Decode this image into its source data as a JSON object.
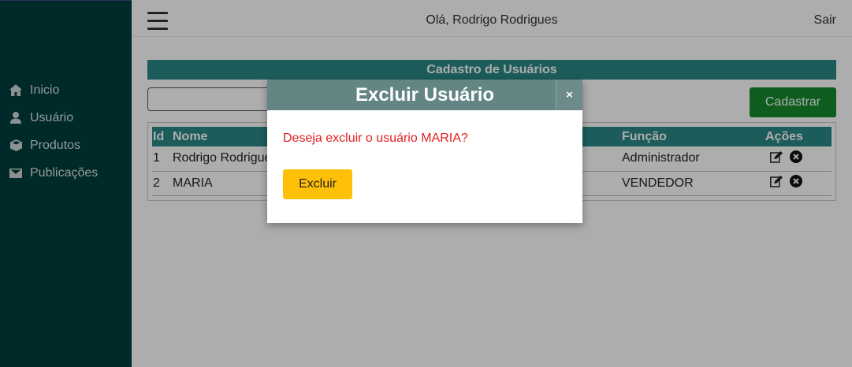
{
  "sidebar": {
    "items": [
      {
        "label": "Inicio",
        "icon": "home-icon"
      },
      {
        "label": "Usuário",
        "icon": "user-icon"
      },
      {
        "label": "Produtos",
        "icon": "cube-icon"
      },
      {
        "label": "Publicações",
        "icon": "envelope-icon"
      }
    ]
  },
  "header": {
    "greeting": "Olá, Rodrigo Rodrigues",
    "logout": "Sair"
  },
  "page": {
    "title": "Cadastro de Usuários",
    "search_value": "",
    "create_label": "Cadastrar"
  },
  "table": {
    "headers": {
      "id": "Id",
      "nome": "Nome",
      "funcao": "Função",
      "acoes": "Ações"
    },
    "rows": [
      {
        "id": "1",
        "nome": "Rodrigo Rodrigues",
        "funcao": "Administrador"
      },
      {
        "id": "2",
        "nome": "MARIA",
        "funcao": "VENDEDOR"
      }
    ]
  },
  "modal": {
    "title": "Excluir Usuário",
    "close": "×",
    "message": "Deseja excluir o usuário MARIA?",
    "confirm_label": "Excluir"
  },
  "colors": {
    "sidebar": "#003d3d",
    "accent": "#2a8a87",
    "create_button": "#168a2e",
    "danger_text": "#e02020",
    "confirm_button": "#ffc107"
  }
}
